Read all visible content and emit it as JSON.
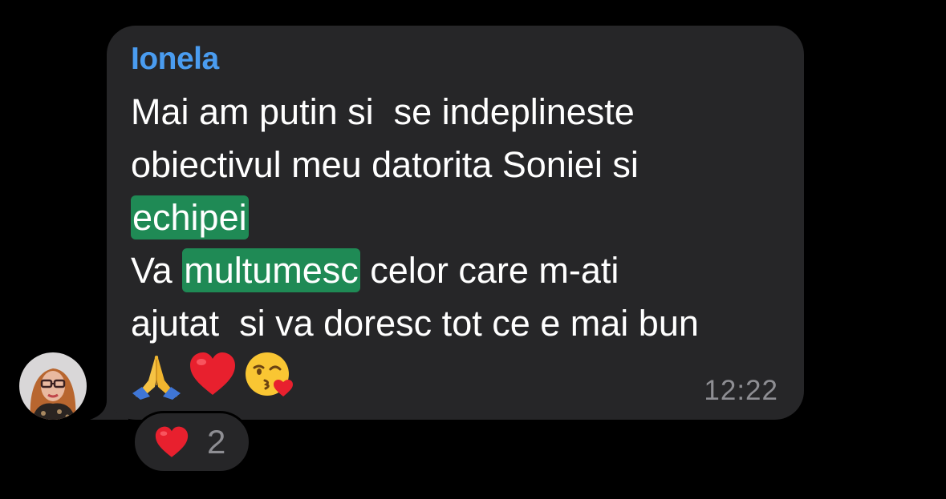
{
  "message": {
    "sender": "Ionela",
    "lines": [
      {
        "segments": [
          {
            "text": "Mai am putin si  se indeplineste",
            "highlight": false
          }
        ]
      },
      {
        "segments": [
          {
            "text": "obiectivul meu datorita Soniei si",
            "highlight": false
          }
        ]
      },
      {
        "segments": [
          {
            "text": "echipei",
            "highlight": true
          }
        ]
      },
      {
        "segments": [
          {
            "text": "Va ",
            "highlight": false
          },
          {
            "text": "multumesc",
            "highlight": true
          },
          {
            "text": " celor care m-ati",
            "highlight": false
          }
        ]
      },
      {
        "segments": [
          {
            "text": "ajutat  si va doresc tot ce e mai bun",
            "highlight": false
          }
        ]
      }
    ],
    "emojis": [
      "folded-hands-emoji",
      "red-heart-emoji",
      "face-blowing-kiss-emoji"
    ],
    "time": "12:22"
  },
  "reaction": {
    "icon": "red-heart-emoji",
    "count": "2"
  },
  "colors": {
    "background": "#000000",
    "bubble": "#262628",
    "sender": "#4a9cf0",
    "highlight": "#1f8a55",
    "meta": "#8e8e93"
  }
}
